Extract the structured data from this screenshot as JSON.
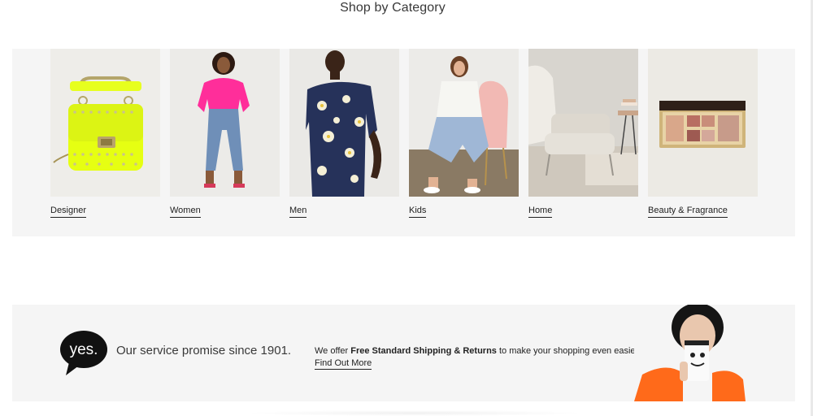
{
  "section": {
    "title": "Shop by Category"
  },
  "categories": [
    {
      "label": "Designer",
      "icon": "designer-handbag-image"
    },
    {
      "label": "Women",
      "icon": "women-model-image"
    },
    {
      "label": "Men",
      "icon": "men-model-image"
    },
    {
      "label": "Kids",
      "icon": "kids-model-image"
    },
    {
      "label": "Home",
      "icon": "home-chair-image"
    },
    {
      "label": "Beauty & Fragrance",
      "icon": "beauty-palette-image"
    }
  ],
  "promo": {
    "logo_text": "yes.",
    "promise": "Our service promise since 1901.",
    "offer_prefix": "We offer ",
    "offer_bold": "Free Standard Shipping & Returns",
    "offer_suffix": " to make your shopping even easier.",
    "link": "Find Out More"
  },
  "colors": {
    "strip_bg": "#f5f5f5",
    "text": "#393939",
    "link": "#222222",
    "accent_pink": "#ff2e9a",
    "accent_neon": "#e6ff1a",
    "accent_orange": "#ff6a1a"
  }
}
